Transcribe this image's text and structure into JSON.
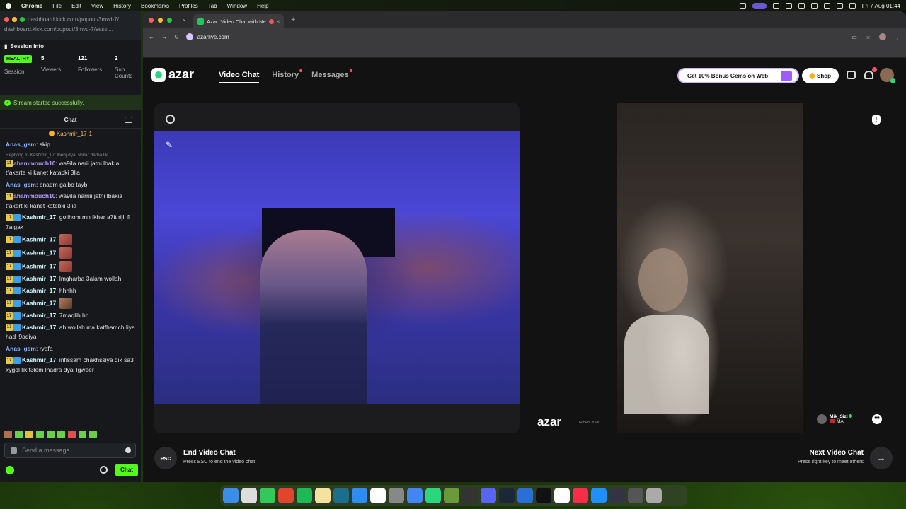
{
  "menubar": {
    "app": "Chrome",
    "items": [
      "File",
      "Edit",
      "View",
      "History",
      "Bookmarks",
      "Profiles",
      "Tab",
      "Window",
      "Help"
    ],
    "ask_gemini": "Ask Gemini",
    "clock": "Fri 7 Aug  01:44"
  },
  "popout": {
    "url_top": "dashboard.kick.com/popout/3mvd-7/...",
    "url": "dashboard.kick.com/popout/3mvd-7/sessi...",
    "session_title": "Session Info",
    "health_badge": "HEALTHY",
    "health_label": "Session",
    "viewers": "5",
    "viewers_label": "Viewers",
    "followers": "121",
    "followers_label": "Followers",
    "subs": "2",
    "subs_label": "Sub Counts",
    "success_msg": "Stream started successfully.",
    "chat_title": "Chat",
    "pinned_user": "Kashmir_17",
    "pinned_count": "1",
    "messages": [
      {
        "user": "Anas_gsm",
        "text": ": skip"
      },
      {
        "reply": "Replying to Kashmir_17: lbenj dyal sbitar darha lik"
      },
      {
        "badge": "11",
        "user": "ahammouch10",
        "text": ": wa9ila narii jatni lbakia tfakarte ki kanet katabki 3lia"
      },
      {
        "user": "Anas_gsm",
        "text": ": bnadm galbo tayb"
      },
      {
        "badge": "11",
        "user": "ahammouch10",
        "text": ": wa9ila narriii jatni lbakia tfakert ki kanet katebki 3lia"
      },
      {
        "badge": "17",
        "user": "Kashmir_17",
        "text": ": golihom mn lkher a7it rijli fi 7algak"
      },
      {
        "badge": "17",
        "user": "Kashmir_17",
        "text": ":"
      },
      {
        "badge": "17",
        "user": "Kashmir_17",
        "text": ":"
      },
      {
        "badge": "17",
        "user": "Kashmir_17",
        "text": ":"
      },
      {
        "badge": "17",
        "user": "Kashmir_17",
        "text": ": lmgharba 3alam wollah"
      },
      {
        "badge": "17",
        "user": "Kashmir_17",
        "text": ": hhhhh"
      },
      {
        "badge": "17",
        "user": "Kashmir_17",
        "text": ":"
      },
      {
        "badge": "17",
        "user": "Kashmir_17",
        "text": ": 7maqlih hh"
      },
      {
        "badge": "17",
        "user": "Kashmir_17",
        "text": ": ah wollah ma katfhamch liya had l9adiya"
      },
      {
        "user": "Anas_gsm",
        "text": ": ryafa"
      },
      {
        "badge": "17",
        "user": "Kashmir_17",
        "text": ": infissam chakhssiya dik sa3 kygol lik t3lem lhadra dyal lgweer"
      }
    ],
    "send_placeholder": "Send a message",
    "chat_button": "Chat"
  },
  "browser": {
    "tab_title": "Azar: Video Chat with Ne",
    "address": "azarlive.com"
  },
  "azar": {
    "logo": "azar",
    "nav": {
      "video_chat": "Video Chat",
      "history": "History",
      "messages": "Messages"
    },
    "promo": "Get 10% Bonus Gems on Web!",
    "shop": "Shop",
    "watermark": "azar",
    "watermark_id": "lRtnF8CY58u",
    "peer_name": "Mik_Sizi",
    "peer_country": "MA",
    "report_glyph": "!",
    "more_glyph": "•••",
    "esc": "esc",
    "end_title": "End Video Chat",
    "end_sub": "Press ESC to end the video chat",
    "next_title": "Next Video Chat",
    "next_sub": "Press right key to meet others",
    "next_arrow": "→"
  },
  "colors": {
    "kick_green": "#53fc18",
    "azar_green": "#2bd77d",
    "local_video_blue": "#4b47d6"
  }
}
